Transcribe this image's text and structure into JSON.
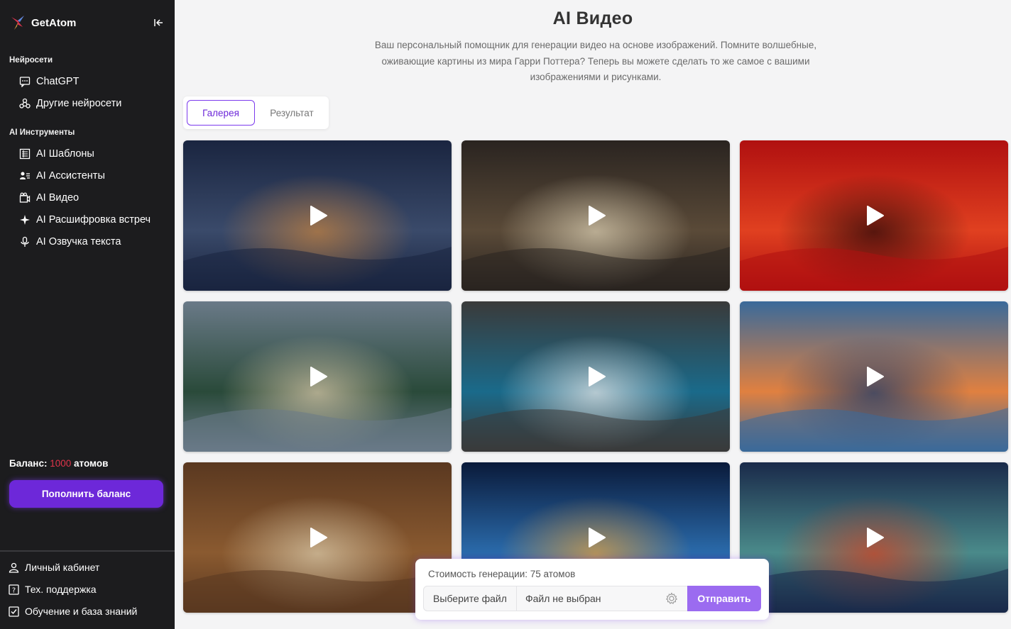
{
  "sidebar": {
    "brand": "GetAtom",
    "sections": [
      {
        "title": "Нейросети",
        "items": [
          {
            "label": "ChatGPT",
            "icon": "chat-icon"
          },
          {
            "label": "Другие нейросети",
            "icon": "network-icon"
          }
        ]
      },
      {
        "title": "AI Инструменты",
        "items": [
          {
            "label": "AI Шаблоны",
            "icon": "template-icon"
          },
          {
            "label": "AI Ассистенты",
            "icon": "assistant-icon"
          },
          {
            "label": "AI Видео",
            "icon": "video-icon"
          },
          {
            "label": "AI Расшифровка встреч",
            "icon": "sparkle-icon"
          },
          {
            "label": "AI Озвучка текста",
            "icon": "microphone-icon"
          }
        ]
      }
    ],
    "balance": {
      "label": "Баланс:",
      "value": "1000",
      "unit": "атомов"
    },
    "topup_label": "Пополнить баланс",
    "bottom_items": [
      {
        "label": "Личный кабинет",
        "icon": "user-icon"
      },
      {
        "label": "Тех. поддержка",
        "icon": "help-icon"
      },
      {
        "label": "Обучение и база знаний",
        "icon": "checklist-icon"
      }
    ]
  },
  "main": {
    "title": "AI Видео",
    "description": "Ваш персональный помощник для генерации видео на основе изображений. Помните волшебные, оживающие картины из мира Гарри Поттера? Теперь вы можете сделать то же самое с вашими изображениями и рисунками.",
    "tabs": [
      {
        "label": "Галерея",
        "active": true
      },
      {
        "label": "Результат",
        "active": false
      }
    ],
    "gallery": [
      {
        "name": "astronauts-moon",
        "colors": [
          "#1a2540",
          "#3a4a6a",
          "#c08040"
        ]
      },
      {
        "name": "painter-vitruvian",
        "colors": [
          "#2a2420",
          "#5a4a38",
          "#d8ccb0"
        ]
      },
      {
        "name": "astronaut-red",
        "colors": [
          "#b01010",
          "#e04020",
          "#2a0808"
        ]
      },
      {
        "name": "tropical-beach",
        "colors": [
          "#6a7a88",
          "#2a4a3a",
          "#d8c8a8"
        ]
      },
      {
        "name": "tree-in-cup",
        "colors": [
          "#3a3a3a",
          "#1a6a8a",
          "#e8e8e8"
        ]
      },
      {
        "name": "blue-train",
        "colors": [
          "#3a6a9a",
          "#e08040",
          "#1a3a6a"
        ]
      },
      {
        "name": "spiral-staircase",
        "colors": [
          "#5a3820",
          "#8a5a30",
          "#d8c8a8"
        ]
      },
      {
        "name": "bearded-warrior",
        "colors": [
          "#0a1a3a",
          "#2a6aaa",
          "#e0a040"
        ]
      },
      {
        "name": "wolf-crystal-ball",
        "colors": [
          "#1a2a4a",
          "#4a8a8a",
          "#d04020"
        ]
      }
    ]
  },
  "generator": {
    "cost_label": "Стоимость генерации: 75 атомов",
    "file_button": "Выберите файл",
    "file_status": "Файл не выбран",
    "send_label": "Отправить"
  },
  "colors": {
    "accent": "#6d28d9",
    "sidebar_bg": "#1c1c1e",
    "balance_value": "#e0344a"
  }
}
